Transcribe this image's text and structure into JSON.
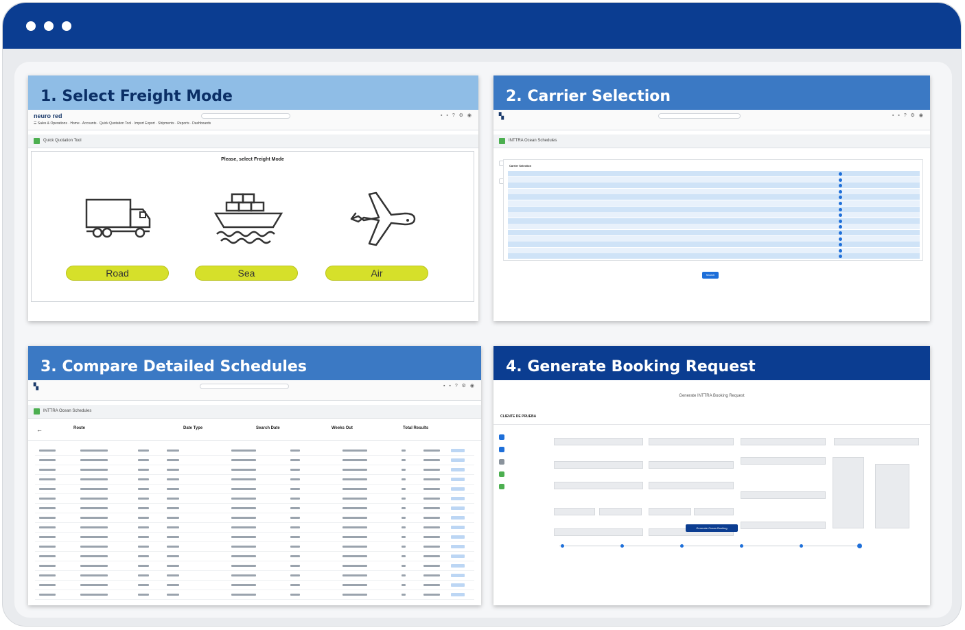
{
  "window": {
    "title_dots": 3
  },
  "panels": {
    "p1": {
      "title": "1. Select Freight Mode",
      "logo": "neuro red",
      "tab_label": "Quick Quotation Tool",
      "prompt": "Please, select Freight Mode",
      "modes": [
        "Road",
        "Sea",
        "Air"
      ],
      "mode_icons": [
        "truck-icon",
        "ship-icon",
        "airplane-icon"
      ]
    },
    "p2": {
      "title": "2. Carrier Selection",
      "tab_label": "INTTRA Ocean Schedules",
      "section_label": "Carrier Selection",
      "search_button": "Search"
    },
    "p3": {
      "title": "3. Compare Detailed Schedules",
      "tab_label": "INTTRA Ocean Schedules",
      "headers": {
        "route": "Route",
        "date_type": "Date Type",
        "search_date": "Search Date",
        "weeks_out": "Weeks Out",
        "total_results": "Total Results"
      }
    },
    "p4": {
      "title": "4. Generate Booking Request",
      "form_title": "Generate INTTRA Booking Request",
      "client": "CLIENTE DE PRUEBA",
      "submit_button": "Generate Ocean Booking"
    }
  },
  "colors": {
    "titlebar": "#0b3d91",
    "head_light": "#8fbde6",
    "head_mid": "#3b79c4",
    "head_dark": "#0b3d91",
    "mode_button": "#d6e02a"
  }
}
